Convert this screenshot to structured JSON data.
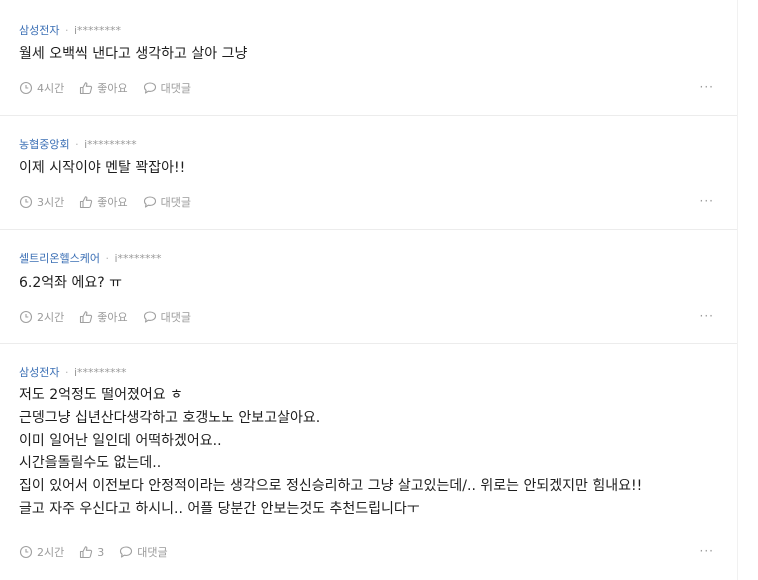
{
  "comments": [
    {
      "company": "삼성전자",
      "user": "i********",
      "lines": [
        "월세 오백씩 낸다고 생각하고 살아 그냥"
      ],
      "time": "4시간",
      "like_label": "좋아요",
      "reply_label": "대댓글",
      "more": "···"
    },
    {
      "company": "농협중앙회",
      "user": "i*********",
      "lines": [
        "이제 시작이야 멘탈 꽉잡아!!"
      ],
      "time": "3시간",
      "like_label": "좋아요",
      "reply_label": "대댓글",
      "more": "···"
    },
    {
      "company": "셀트리온헬스케어",
      "user": "i********",
      "lines": [
        "6.2억좌 에요? ㅠ"
      ],
      "time": "2시간",
      "like_label": "좋아요",
      "reply_label": "대댓글",
      "more": "···"
    },
    {
      "company": "삼성전자",
      "user": "i*********",
      "lines": [
        "저도 2억정도 떨어졌어요 ㅎ",
        "근뎅그냥 십년산다생각하고 호갱노노 안보고살아요.",
        "이미 일어난 일인데 어떡하겠어요..",
        "시간을돌릴수도 없는데..",
        "집이 있어서 이전보다 안정적이라는 생각으로 정신승리하고 그냥 살고있는데/.. 위로는 안되겠지만 힘내요!!",
        "글고 자주 우신다고 하시니.. 어플 당분간 안보는것도 추천드립니다ㅜ"
      ],
      "time": "2시간",
      "like_label": "3",
      "reply_label": "대댓글",
      "more": "···"
    }
  ],
  "icons": {
    "clock": "clock-icon",
    "like": "thumbs-up-icon",
    "reply": "speech-bubble-icon",
    "more": "more-options-icon"
  },
  "colors": {
    "company": "#3b6fb5",
    "meta": "#9a9a9a",
    "text": "#1e1e1e",
    "divider": "#ececec"
  }
}
